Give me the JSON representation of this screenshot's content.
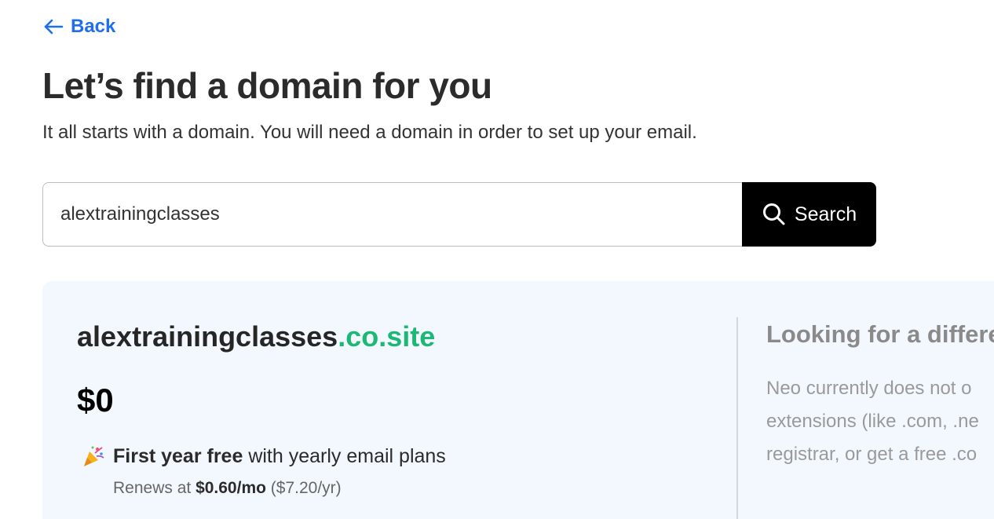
{
  "nav": {
    "back_label": "Back"
  },
  "header": {
    "title": "Let’s find a domain for you",
    "subtitle": "It all starts with a domain. You will need a domain in order to set up your email."
  },
  "search": {
    "value": "alextrainingclasses",
    "button_label": "Search"
  },
  "result": {
    "domain_base": "alextrainingclasses",
    "domain_extension": ".co.site",
    "price": "$0",
    "offer_bold": "First year free",
    "offer_rest": " with yearly email plans",
    "renew_prefix": "Renews at ",
    "renew_monthly": "$0.60/mo",
    "renew_yearly": " ($7.20/yr)"
  },
  "alternative": {
    "title": "Looking for a differe",
    "lines": [
      "Neo currently does not o",
      "extensions (like .com, .ne",
      "registrar, or get a free .co"
    ]
  },
  "colors": {
    "link": "#1f6ef0",
    "extension_green": "#1db876",
    "card_bg": "#f3f8fe",
    "button_bg": "#000000"
  },
  "icons": {
    "back": "arrow-left-icon",
    "search": "search-icon",
    "offer": "party-popper-icon"
  }
}
